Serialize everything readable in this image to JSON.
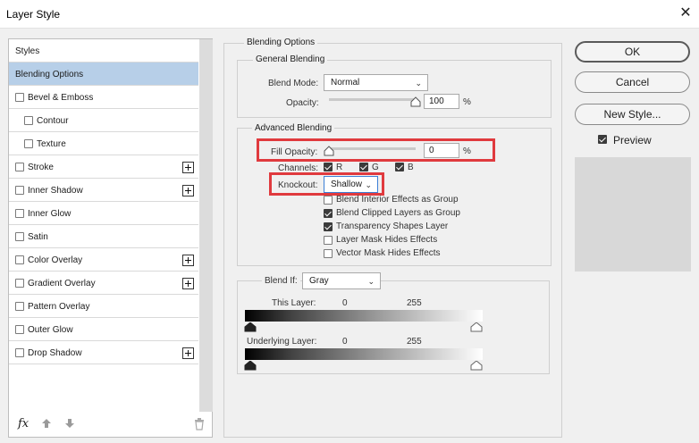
{
  "window": {
    "title": "Layer Style",
    "close_glyph": "✕"
  },
  "styles_list": {
    "header": "Styles",
    "items": [
      {
        "label": "Blending Options",
        "checkbox": false,
        "plus": false,
        "indent": false,
        "selected": true
      },
      {
        "label": "Bevel & Emboss",
        "checkbox": true,
        "plus": false,
        "indent": false,
        "selected": false
      },
      {
        "label": "Contour",
        "checkbox": true,
        "plus": false,
        "indent": true,
        "selected": false
      },
      {
        "label": "Texture",
        "checkbox": true,
        "plus": false,
        "indent": true,
        "selected": false
      },
      {
        "label": "Stroke",
        "checkbox": true,
        "plus": true,
        "indent": false,
        "selected": false
      },
      {
        "label": "Inner Shadow",
        "checkbox": true,
        "plus": true,
        "indent": false,
        "selected": false
      },
      {
        "label": "Inner Glow",
        "checkbox": true,
        "plus": false,
        "indent": false,
        "selected": false
      },
      {
        "label": "Satin",
        "checkbox": true,
        "plus": false,
        "indent": false,
        "selected": false
      },
      {
        "label": "Color Overlay",
        "checkbox": true,
        "plus": true,
        "indent": false,
        "selected": false
      },
      {
        "label": "Gradient Overlay",
        "checkbox": true,
        "plus": true,
        "indent": false,
        "selected": false
      },
      {
        "label": "Pattern Overlay",
        "checkbox": true,
        "plus": false,
        "indent": false,
        "selected": false
      },
      {
        "label": "Outer Glow",
        "checkbox": true,
        "plus": false,
        "indent": false,
        "selected": false
      },
      {
        "label": "Drop Shadow",
        "checkbox": true,
        "plus": true,
        "indent": false,
        "selected": false
      }
    ],
    "footer": {
      "fx": "fx",
      "up_icon": "arrow-up-icon",
      "down_icon": "arrow-down-icon",
      "trash_icon": "trash-icon"
    }
  },
  "blending_options": {
    "title": "Blending Options",
    "general": {
      "title": "General Blending",
      "blend_mode_label": "Blend Mode:",
      "blend_mode_value": "Normal",
      "opacity_label": "Opacity:",
      "opacity_value": "100",
      "opacity_fraction": 1.0,
      "unit": "%"
    },
    "advanced": {
      "title": "Advanced Blending",
      "fill_opacity_label": "Fill Opacity:",
      "fill_opacity_value": "0",
      "fill_opacity_fraction": 0.0,
      "unit": "%",
      "channels_label": "Channels:",
      "channels": [
        {
          "label": "R",
          "checked": true
        },
        {
          "label": "G",
          "checked": true
        },
        {
          "label": "B",
          "checked": true
        }
      ],
      "knockout_label": "Knockout:",
      "knockout_value": "Shallow",
      "options": [
        {
          "label": "Blend Interior Effects as Group",
          "checked": false
        },
        {
          "label": "Blend Clipped Layers as Group",
          "checked": true
        },
        {
          "label": "Transparency Shapes Layer",
          "checked": true
        },
        {
          "label": "Layer Mask Hides Effects",
          "checked": false
        },
        {
          "label": "Vector Mask Hides Effects",
          "checked": false
        }
      ]
    },
    "blend_if": {
      "label": "Blend If:",
      "value": "Gray",
      "this_layer_label": "This Layer:",
      "this_layer_min": "0",
      "this_layer_max": "255",
      "underlying_label": "Underlying Layer:",
      "underlying_min": "0",
      "underlying_max": "255"
    }
  },
  "buttons": {
    "ok": "OK",
    "cancel": "Cancel",
    "new_style": "New Style..."
  },
  "preview": {
    "label": "Preview",
    "checked": true
  },
  "colors": {
    "highlight": "#e03a3e",
    "selected_row": "#b7cfe8"
  }
}
